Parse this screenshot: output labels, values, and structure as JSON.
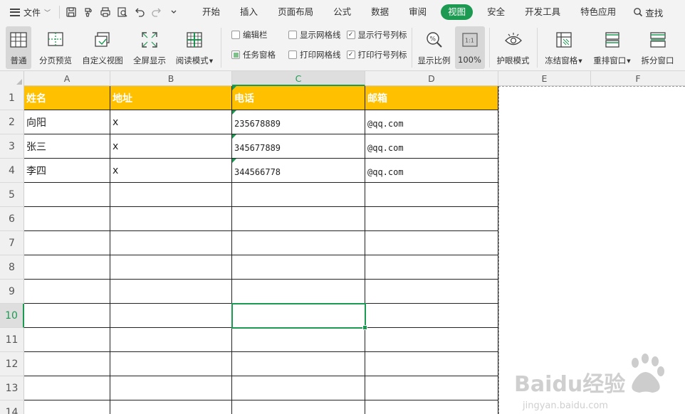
{
  "menu": {
    "file_label": "文件"
  },
  "tabs": [
    "开始",
    "插入",
    "页面布局",
    "公式",
    "数据",
    "审阅",
    "视图",
    "安全",
    "开发工具",
    "特色应用"
  ],
  "active_tab": "视图",
  "search_label": "查找",
  "ribbon": {
    "buttons": {
      "normal": "普通",
      "page_break_preview": "分页预览",
      "custom_view": "自定义视图",
      "full_screen": "全屏显示",
      "reading_mode": "阅读模式",
      "zoom": "显示比例",
      "hundred_percent": "100%",
      "eye_protection": "护眼模式",
      "freeze_panes": "冻结窗格",
      "arrange_windows": "重排窗口",
      "split_window": "拆分窗口"
    },
    "zoom_icon_text": "1:1",
    "checkboxes": {
      "formula_bar": {
        "label": "编辑栏",
        "checked": false
      },
      "task_pane": {
        "label": "任务窗格",
        "checked": true
      },
      "show_gridlines": {
        "label": "显示网格线",
        "checked": false
      },
      "print_gridlines": {
        "label": "打印网格线",
        "checked": false
      },
      "show_row_col_headers": {
        "label": "显示行号列标",
        "checked": true
      },
      "print_row_col_headers": {
        "label": "打印行号列标",
        "checked": true
      }
    },
    "check_mark": "✓"
  },
  "sheet": {
    "columns": [
      "A",
      "B",
      "C",
      "D",
      "E",
      "F"
    ],
    "active_column": "C",
    "row_numbers": [
      "1",
      "2",
      "3",
      "4",
      "5",
      "6",
      "7",
      "8",
      "9",
      "10",
      "11",
      "12",
      "13",
      "14"
    ],
    "active_row": "10",
    "header_fill": "#ffc000",
    "accent": "#1d9a52",
    "headers": [
      "姓名",
      "地址",
      "电话",
      "邮箱"
    ],
    "rows": [
      [
        "向阳",
        "x",
        "235678889",
        "@qq.com"
      ],
      [
        "张三",
        "x",
        "345677889",
        "@qq.com"
      ],
      [
        "李四",
        "x",
        "344566778",
        "@qq.com"
      ]
    ]
  },
  "watermark": {
    "brand": "Baidu经验",
    "url": "jingyan.baidu.com"
  }
}
